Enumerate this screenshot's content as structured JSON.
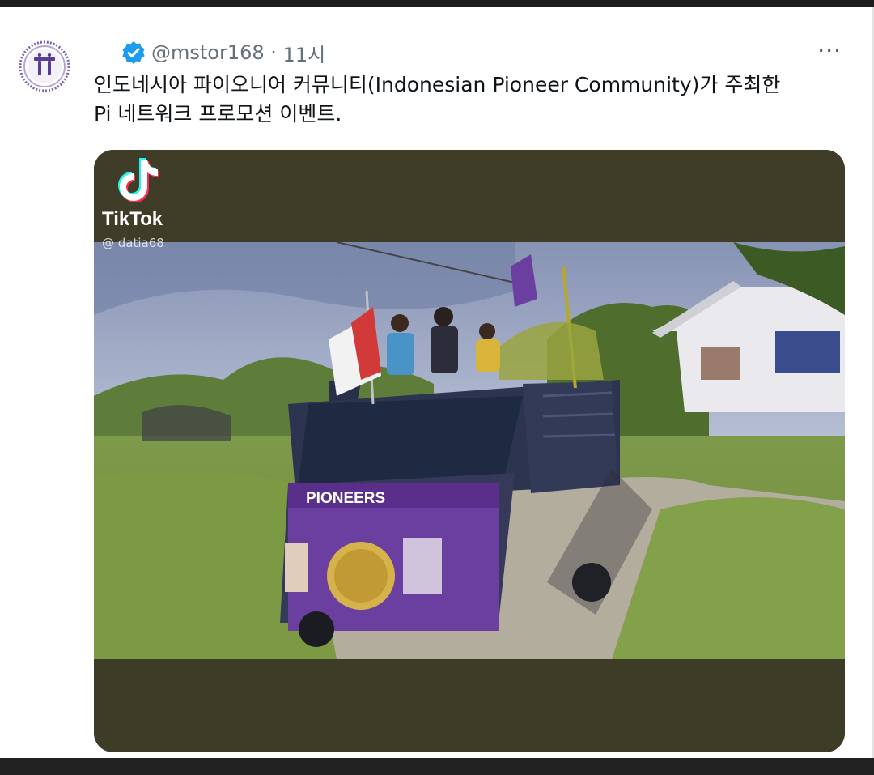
{
  "tweet": {
    "handle": "@mstor168",
    "separator": " · ",
    "time": "11시",
    "text_line1": "인도네시아 파이오니어 커뮤니티(Indonesian Pioneer Community)가 주최한",
    "text_line2": "Pi 네트워크 프로모션 이벤트.",
    "more_label": "···"
  },
  "media": {
    "tiktok_label": "TikTok",
    "tiktok_user": "@ datia68",
    "banner_text": "PIONEERS"
  },
  "colors": {
    "avatar_ring": "#6a4c9c",
    "verified": "#1d9bf0",
    "banner": "#6b3fa0"
  },
  "icons": {
    "avatar": "pi-network-logo",
    "verified": "verified-badge-icon",
    "more": "more-icon",
    "tiktok": "tiktok-logo-icon"
  }
}
